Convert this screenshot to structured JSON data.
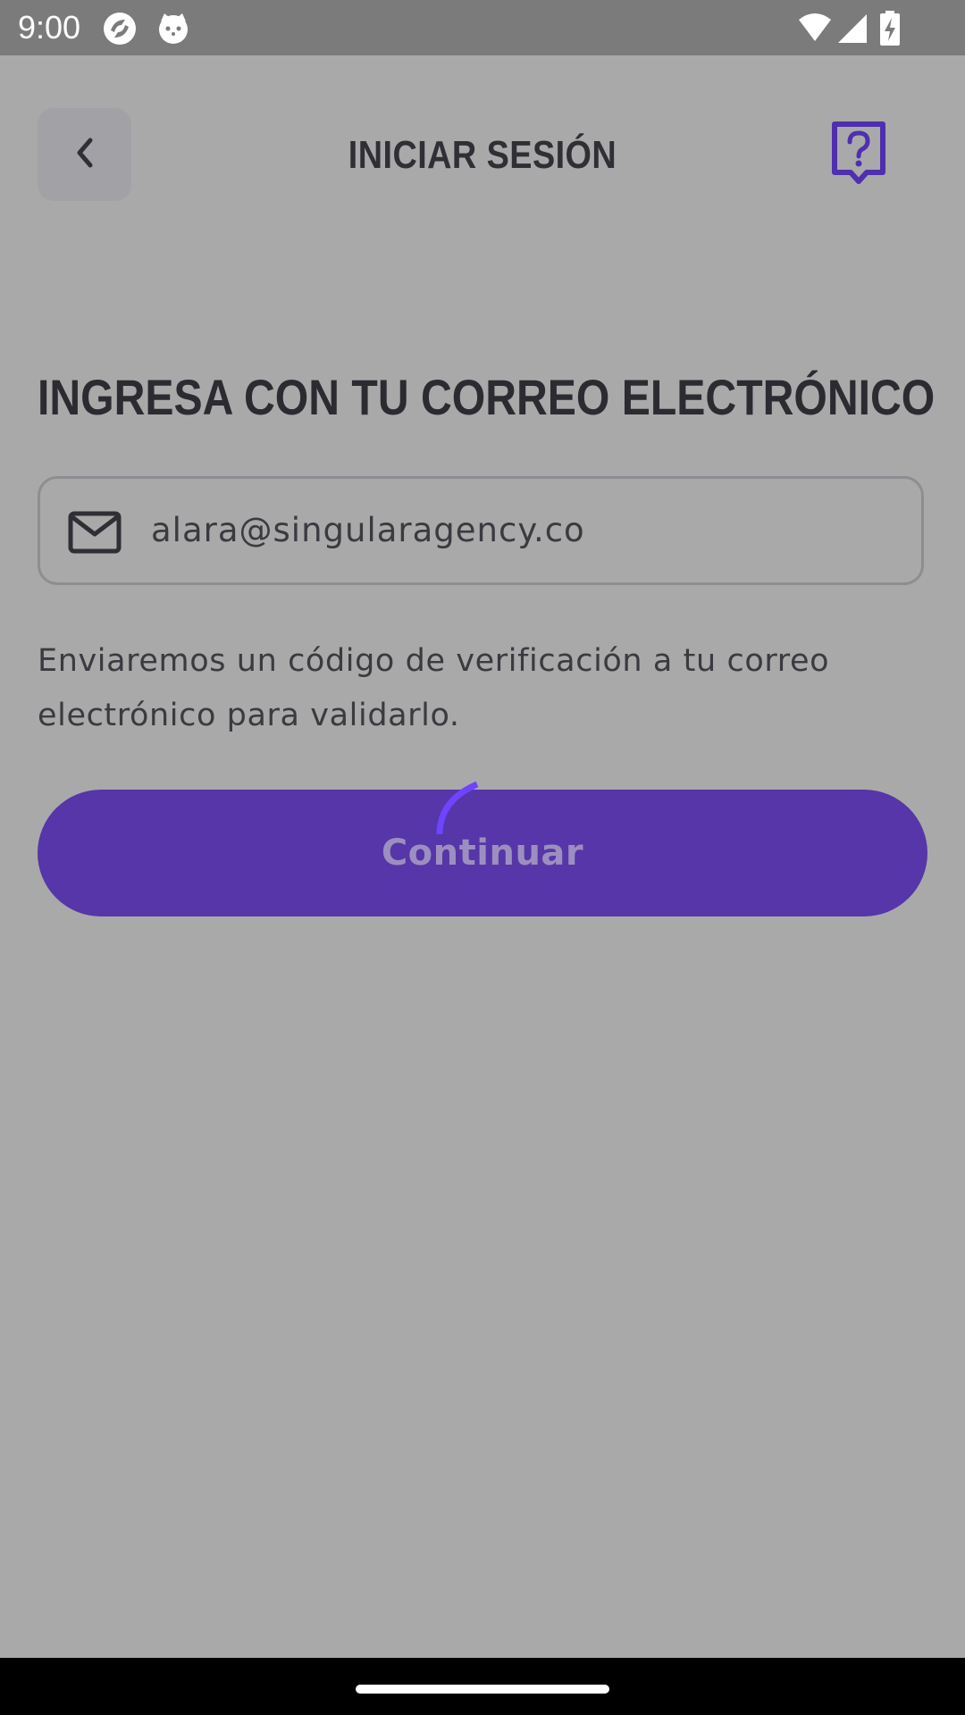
{
  "status_bar": {
    "time": "9:00",
    "icons": [
      "app-notification-icon",
      "cat-notification-icon",
      "wifi-icon",
      "signal-icon",
      "battery-charging-icon"
    ]
  },
  "header": {
    "title": "INICIAR SESIÓN",
    "back_icon": "chevron-left-icon",
    "help_icon": "help-question-icon"
  },
  "main": {
    "heading": "INGRESA CON TU CORREO ELECTRÓNICO",
    "email_field": {
      "icon": "mail-icon",
      "value": "alara@singularagency.co"
    },
    "description": "Enviaremos un código de verificación a tu correo electrónico para validarlo.",
    "continue_label": "Continuar",
    "loading": true
  },
  "colors": {
    "accent": "#5636a8",
    "overlay_background": "#a9a9a9",
    "spinner": "#6e44ff"
  }
}
